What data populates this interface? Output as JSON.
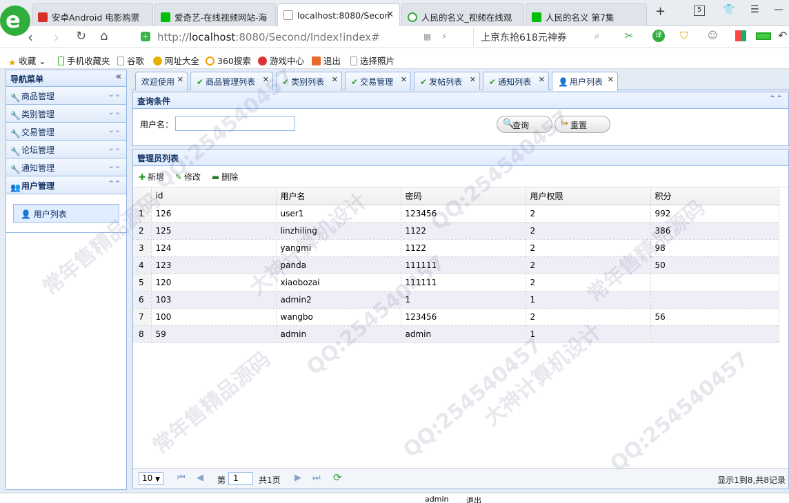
{
  "browser": {
    "tabs": [
      {
        "label": "安卓Android 电影购票",
        "icon": "red-square-icon",
        "color": "#d93025"
      },
      {
        "label": "爱奇艺-在线视频网站-海",
        "icon": "iqiyi-icon",
        "color": "#00be06"
      },
      {
        "label": "localhost:8080/Secon",
        "icon": "page-icon",
        "color": "#999999"
      },
      {
        "label": "人民的名义_视频在线观",
        "icon": "play-icon",
        "color": "#3aa83a"
      },
      {
        "label": "人民的名义 第7集",
        "icon": "iqiyi-icon",
        "color": "#00be06"
      }
    ],
    "active_tab": 2,
    "new_tab": "+",
    "tab_count": "5",
    "url_prefix": "http://",
    "url_host": "localhost",
    "url_rest": ":8080/Second/Index!index#",
    "search_hint": "上京东抢618元神券",
    "bookmarks": [
      "收藏",
      "手机收藏夹",
      "谷歌",
      "网址大全",
      "360搜索",
      "游戏中心",
      "退出",
      "选择照片"
    ]
  },
  "nav": {
    "title": "导航菜单",
    "sections": [
      "商品管理",
      "类别管理",
      "交易管理",
      "论坛管理",
      "通知管理",
      "用户管理"
    ],
    "open_item": "用户列表"
  },
  "content_tabs": [
    "欢迎使用",
    "商品管理列表",
    "类别列表",
    "交易管理",
    "发帖列表",
    "通知列表",
    "用户列表"
  ],
  "query": {
    "title": "查询条件",
    "username_label": "用户名：",
    "username_value": "",
    "search_button": "查询",
    "reset_button": "重置"
  },
  "grid": {
    "title": "管理员列表",
    "toolbar": {
      "add": "新增",
      "edit": "修改",
      "delete": "删除"
    },
    "columns": [
      "id",
      "用户名",
      "密码",
      "用户权限",
      "积分"
    ],
    "rows": [
      [
        "1",
        "126",
        "user1",
        "123456",
        "2",
        "992"
      ],
      [
        "2",
        "125",
        "linzhiling",
        "1122",
        "2",
        "386"
      ],
      [
        "3",
        "124",
        "yangmi",
        "1122",
        "2",
        "98"
      ],
      [
        "4",
        "123",
        "panda",
        "111111",
        "2",
        "50"
      ],
      [
        "5",
        "120",
        "xiaobozai",
        "111111",
        "2",
        ""
      ],
      [
        "6",
        "103",
        "admin2",
        "1",
        "1",
        ""
      ],
      [
        "7",
        "100",
        "wangbo",
        "123456",
        "2",
        "56"
      ],
      [
        "8",
        "59",
        "admin",
        "admin",
        "1",
        ""
      ]
    ]
  },
  "pager": {
    "page_size": "10",
    "page_prefix": "第",
    "page_value": "1",
    "page_total": "共1页",
    "summary": "显示1到8,共8记录"
  },
  "status": {
    "user": "admin",
    "logout": "退出"
  },
  "watermarks": [
    "常年售精品源码",
    "QQ:254540457",
    "大神计算机设计"
  ]
}
